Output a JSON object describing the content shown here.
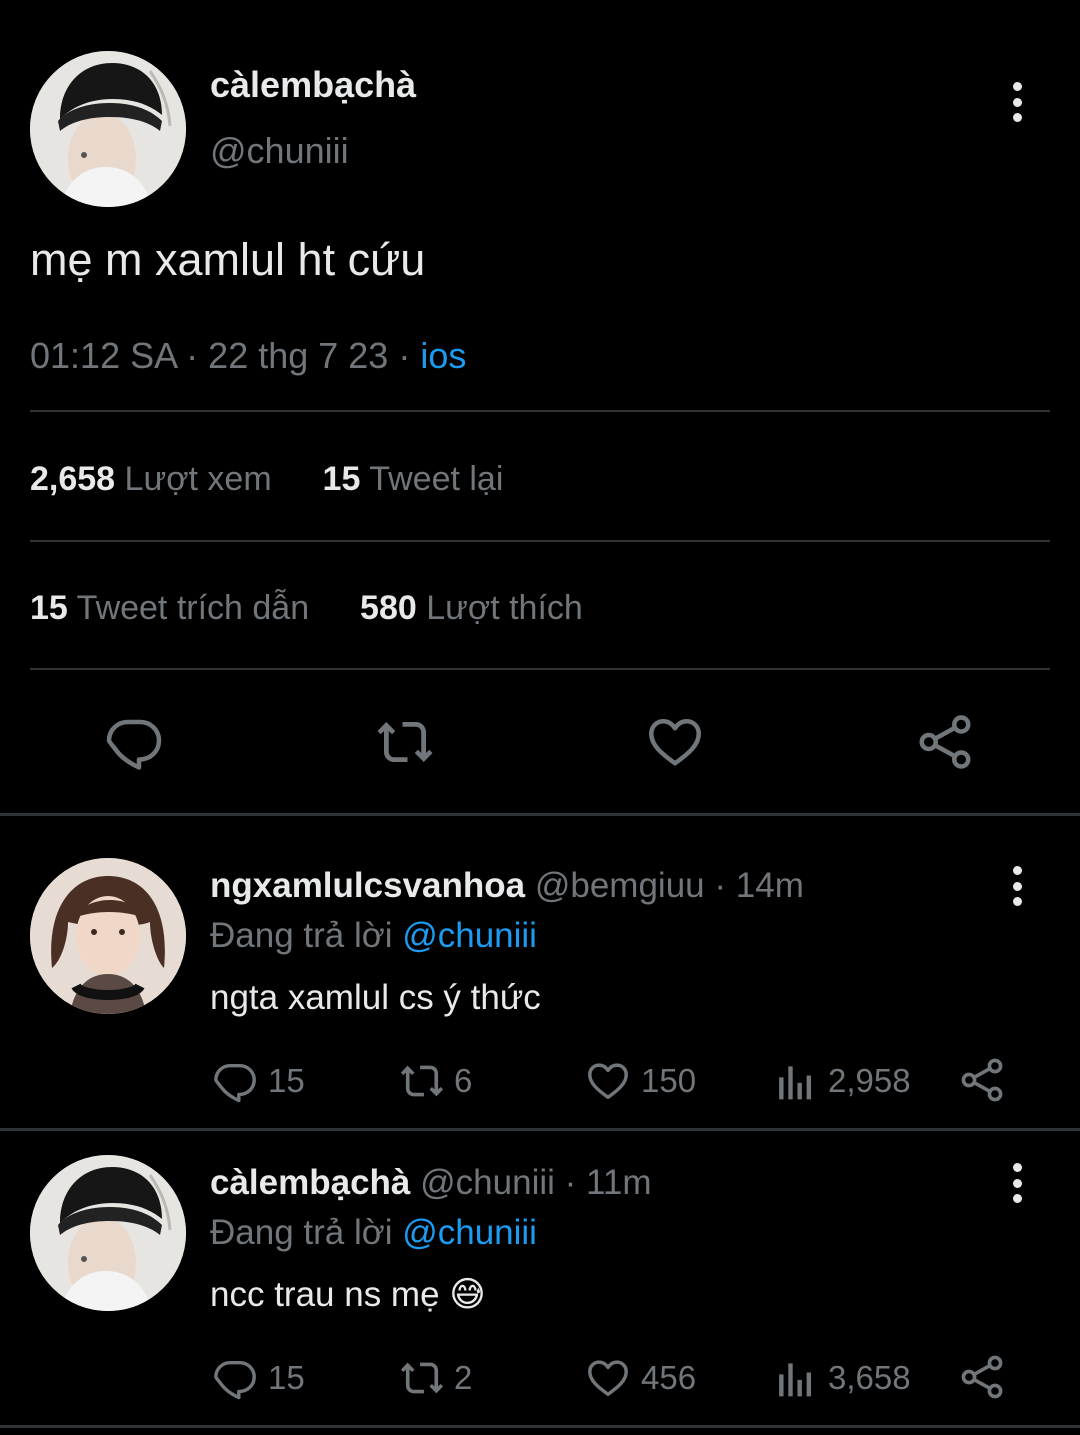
{
  "main_tweet": {
    "display_name": "càlembạchà",
    "handle": "@chuniii",
    "text": "mẹ m xamlul ht cứu",
    "time": "01:12 SA",
    "date": "22 thg 7 23",
    "source": "ios",
    "stats": {
      "views_count": "2,658",
      "views_label": "Lượt xem",
      "retweets_count": "15",
      "retweets_label": "Tweet lại",
      "quotes_count": "15",
      "quotes_label": "Tweet trích dẫn",
      "likes_count": "580",
      "likes_label": "Lượt thích"
    },
    "actions": [
      "reply-icon",
      "retweet-icon",
      "like-icon",
      "share-icon"
    ]
  },
  "replies": [
    {
      "display_name": "ngxamlulcsvanhoa",
      "handle": "@bemgiuu",
      "time": "14m",
      "replying_prefix": "Đang trả lời",
      "replying_to": "@chuniii",
      "text": "ngta xamlul cs ý thức",
      "reply_count": "15",
      "retweet_count": "6",
      "like_count": "150",
      "view_count": "2,958"
    },
    {
      "display_name": "càlembạchà",
      "handle": "@chuniii",
      "time": "11m",
      "replying_prefix": "Đang trả lời",
      "replying_to": "@chuniii",
      "text": "ncc trau ns mẹ",
      "emoji": "😅",
      "reply_count": "15",
      "retweet_count": "2",
      "like_count": "456",
      "view_count": "3,658"
    }
  ],
  "colors": {
    "background": "#000000",
    "text": "#e7e9ea",
    "muted": "#71767b",
    "accent": "#1d9bf0",
    "divider": "#2f3336"
  }
}
